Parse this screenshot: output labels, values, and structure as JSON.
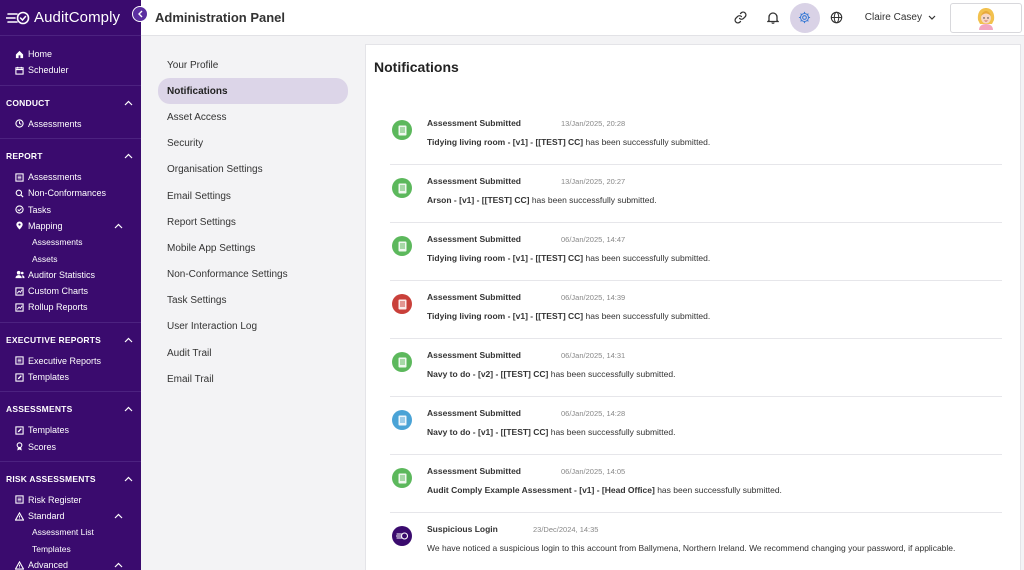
{
  "brand": {
    "name": "AuditComply"
  },
  "header": {
    "title": "Administration Panel",
    "user_name": "Claire Casey"
  },
  "colors": {
    "sidebar": "#3a0b6e",
    "accent": "#5b2ea0",
    "active_tab": "#dcd5e8",
    "green": "#5cb85c",
    "red": "#c9403a",
    "blue": "#4aa3d6",
    "purple": "#3a0b6e"
  },
  "sidebar": {
    "top": [
      {
        "label": "Home",
        "icon": "home-icon"
      },
      {
        "label": "Scheduler",
        "icon": "calendar-icon"
      }
    ],
    "conduct": {
      "title": "CONDUCT",
      "items": [
        {
          "label": "Assessments",
          "icon": "clock-icon"
        }
      ]
    },
    "report": {
      "title": "REPORT",
      "items": [
        {
          "label": "Assessments",
          "icon": "list-icon"
        },
        {
          "label": "Non-Conformances",
          "icon": "search-icon"
        },
        {
          "label": "Tasks",
          "icon": "check-circle-icon"
        },
        {
          "label": "Mapping",
          "icon": "map-pin-icon"
        },
        {
          "label": "Assessments",
          "icon": ""
        },
        {
          "label": "Assets",
          "icon": ""
        },
        {
          "label": "Auditor Statistics",
          "icon": "users-icon"
        },
        {
          "label": "Custom Charts",
          "icon": "chart-icon"
        },
        {
          "label": "Rollup Reports",
          "icon": "chart-icon"
        }
      ]
    },
    "executive": {
      "title": "EXECUTIVE REPORTS",
      "items": [
        {
          "label": "Executive Reports",
          "icon": "list-icon"
        },
        {
          "label": "Templates",
          "icon": "edit-icon"
        }
      ]
    },
    "assessments": {
      "title": "ASSESSMENTS",
      "items": [
        {
          "label": "Templates",
          "icon": "edit-icon"
        },
        {
          "label": "Scores",
          "icon": "award-icon"
        }
      ]
    },
    "risk": {
      "title": "RISK ASSESSMENTS",
      "items": [
        {
          "label": "Risk Register",
          "icon": "list-icon"
        },
        {
          "label": "Standard",
          "icon": "warning-icon"
        },
        {
          "label": "Assessment List",
          "icon": ""
        },
        {
          "label": "Templates",
          "icon": ""
        },
        {
          "label": "Advanced",
          "icon": "warning-icon"
        }
      ]
    }
  },
  "subnav": [
    "Your Profile",
    "Notifications",
    "Asset Access",
    "Security",
    "Organisation Settings",
    "Email Settings",
    "Report Settings",
    "Mobile App Settings",
    "Non-Conformance Settings",
    "Task Settings",
    "User Interaction Log",
    "Audit Trail",
    "Email Trail"
  ],
  "panel": {
    "title": "Notifications"
  },
  "notifications": [
    {
      "title": "Assessment Submitted",
      "time": "13/Jan/2025, 20:28",
      "bold": "Tidying living room - [v1] - [[TEST] CC]",
      "rest": " has been successfully submitted.",
      "color": "green"
    },
    {
      "title": "Assessment Submitted",
      "time": "13/Jan/2025, 20:27",
      "bold": "Arson - [v1] - [[TEST] CC]",
      "rest": " has been successfully submitted.",
      "color": "green"
    },
    {
      "title": "Assessment Submitted",
      "time": "06/Jan/2025, 14:47",
      "bold": "Tidying living room - [v1] - [[TEST] CC]",
      "rest": " has been successfully submitted.",
      "color": "green"
    },
    {
      "title": "Assessment Submitted",
      "time": "06/Jan/2025, 14:39",
      "bold": "Tidying living room - [v1] - [[TEST] CC]",
      "rest": " has been successfully submitted.",
      "color": "red"
    },
    {
      "title": "Assessment Submitted",
      "time": "06/Jan/2025, 14:31",
      "bold": "Navy to do - [v2] - [[TEST] CC]",
      "rest": " has been successfully submitted.",
      "color": "green"
    },
    {
      "title": "Assessment Submitted",
      "time": "06/Jan/2025, 14:28",
      "bold": "Navy to do - [v1] - [[TEST] CC]",
      "rest": " has been successfully submitted.",
      "color": "blue"
    },
    {
      "title": "Assessment Submitted",
      "time": "06/Jan/2025, 14:05",
      "bold": "Audit Comply Example Assessment - [v1] - [Head Office]",
      "rest": " has been successfully submitted.",
      "color": "green"
    },
    {
      "title": "Suspicious Login",
      "time": "23/Dec/2024, 14:35",
      "bold": "",
      "rest": "We have noticed a suspicious login to this account from Ballymena, Northern Ireland. We recommend changing your password, if applicable.",
      "color": "purple"
    }
  ]
}
